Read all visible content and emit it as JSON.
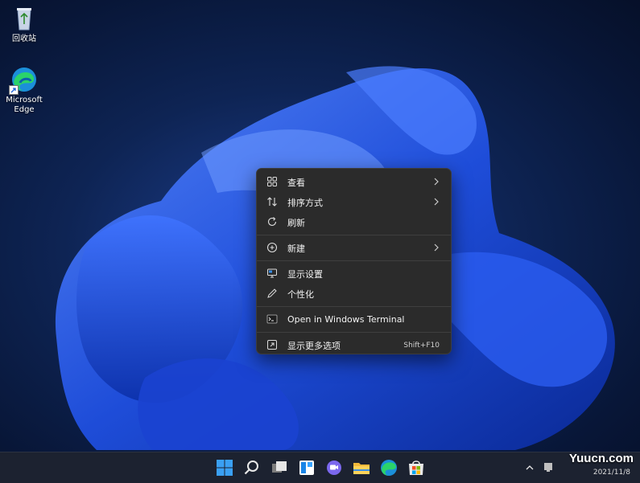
{
  "desktop": {
    "icons": [
      {
        "label": "回收站",
        "icon": "recycle-bin-icon"
      },
      {
        "label": "Microsoft Edge",
        "line1": "Microsoft",
        "line2": "Edge",
        "icon": "edge-icon"
      }
    ]
  },
  "context_menu": {
    "items": [
      {
        "label": "查看",
        "icon": "view-grid-icon",
        "submenu": true
      },
      {
        "label": "排序方式",
        "icon": "sort-icon",
        "submenu": true
      },
      {
        "label": "刷新",
        "icon": "refresh-icon",
        "submenu": false
      },
      {
        "label": "新建",
        "icon": "new-plus-icon",
        "submenu": true
      },
      {
        "label": "显示设置",
        "icon": "display-settings-icon",
        "submenu": false
      },
      {
        "label": "个性化",
        "icon": "pen-icon",
        "submenu": false
      },
      {
        "label": "Open in Windows Terminal",
        "icon": "terminal-icon",
        "submenu": false
      },
      {
        "label": "显示更多选项",
        "icon": "more-options-icon",
        "shortcut": "Shift+F10"
      }
    ]
  },
  "taskbar": {
    "apps": [
      "start-icon",
      "search-icon",
      "task-view-icon",
      "widgets-icon",
      "teams-chat-icon",
      "file-explorer-icon",
      "edge-icon",
      "store-icon"
    ],
    "clock_date": "2021/11/8"
  },
  "watermark": "Yuucn.com",
  "colors": {
    "accent": "#0078d4",
    "menu_bg": "#2b2b2b",
    "taskbar_bg": "#1c2230"
  }
}
